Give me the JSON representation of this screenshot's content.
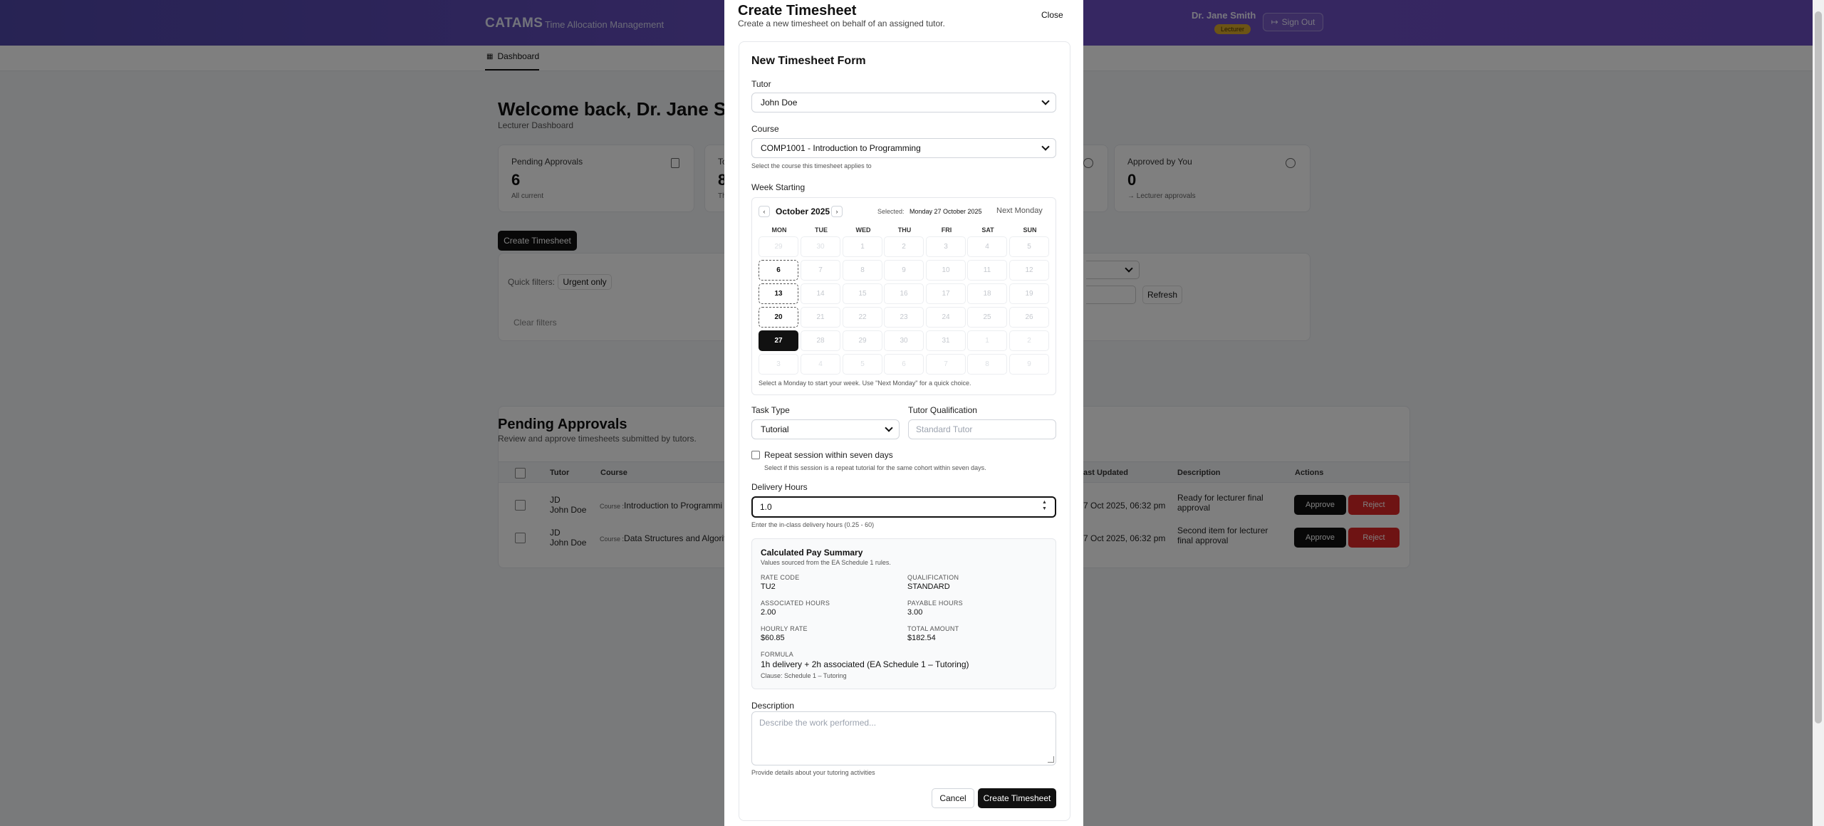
{
  "app": {
    "brand": "CATAMS",
    "brand_sub": "Time Allocation Management",
    "user_name": "Dr. Jane Smith",
    "role": "Lecturer",
    "sign_out": "Sign Out",
    "nav_dashboard": "Dashboard"
  },
  "dashboard": {
    "welcome": "Welcome back, Dr. Jane Smith",
    "subtitle": "Lecturer Dashboard",
    "stats": [
      {
        "label": "Pending Approvals",
        "value": "6",
        "note": "All current"
      },
      {
        "label": "To",
        "value": "8",
        "note": "Th"
      },
      {
        "label": "Approved by You",
        "value": "0",
        "note": "→ Lecturer approvals"
      }
    ],
    "create_btn": "Create Timesheet",
    "quick_filters_label": "Quick filters:",
    "urgent_only": "Urgent only",
    "clear_filters": "Clear filters",
    "refresh": "Refresh"
  },
  "pending": {
    "title": "Pending Approvals",
    "subtitle": "Review and approve timesheets submitted by tutors.",
    "headers": {
      "tutor": "Tutor",
      "course": "Course",
      "updated": "ast Updated",
      "description": "Description",
      "actions": "Actions"
    },
    "rows": [
      {
        "initials": "JD",
        "name": "John Doe",
        "course_tag": "Course",
        "course": "Introduction to Programmi",
        "updated": "7 Oct 2025, 06:32 pm",
        "description": "Ready for lecturer final approval"
      },
      {
        "initials": "JD",
        "name": "John Doe",
        "course_tag": "Course",
        "course": "Data Structures and Algorit",
        "updated": "7 Oct 2025, 06:32 pm",
        "description": "Second item for lecturer final approval"
      }
    ],
    "approve": "Approve",
    "reject": "Reject"
  },
  "modal": {
    "title": "Create Timesheet",
    "subtitle": "Create a new timesheet on behalf of an assigned tutor.",
    "close": "Close",
    "form_title": "New Timesheet Form",
    "tutor_label": "Tutor",
    "tutor_value": "John Doe",
    "course_label": "Course",
    "course_value": "COMP1001 - Introduction to Programming",
    "course_hint": "Select the course this timesheet applies to",
    "week_label": "Week Starting",
    "calendar": {
      "prev": "‹",
      "next": "›",
      "month": "October 2025",
      "selected_label": "Selected:",
      "selected_value": "Monday 27 October 2025",
      "next_monday": "Next Monday",
      "weekdays": [
        "MON",
        "TUE",
        "WED",
        "THU",
        "FRI",
        "SAT",
        "SUN"
      ],
      "weeks": [
        [
          "29",
          "30",
          "1",
          "2",
          "3",
          "4",
          "5"
        ],
        [
          "6",
          "7",
          "8",
          "9",
          "10",
          "11",
          "12"
        ],
        [
          "13",
          "14",
          "15",
          "16",
          "17",
          "18",
          "19"
        ],
        [
          "20",
          "21",
          "22",
          "23",
          "24",
          "25",
          "26"
        ],
        [
          "27",
          "28",
          "29",
          "30",
          "31",
          "1",
          "2"
        ],
        [
          "3",
          "4",
          "5",
          "6",
          "7",
          "8",
          "9"
        ]
      ],
      "hint": "Select a Monday to start your week. Use \"Next Monday\" for a quick choice."
    },
    "task_type_label": "Task Type",
    "task_type_value": "Tutorial",
    "qualification_label": "Tutor Qualification",
    "qualification_placeholder": "Standard Tutor",
    "repeat_label": "Repeat session within seven days",
    "repeat_hint": "Select if this session is a repeat tutorial for the same cohort within seven days.",
    "hours_label": "Delivery Hours",
    "hours_value": "1.0",
    "hours_hint": "Enter the in-class delivery hours (0.25 - 60)",
    "pay": {
      "title": "Calculated Pay Summary",
      "subtitle": "Values sourced from the EA Schedule 1 rules.",
      "rate_code_label": "RATE CODE",
      "rate_code": "TU2",
      "qualification_label": "QUALIFICATION",
      "qualification": "STANDARD",
      "associated_label": "ASSOCIATED HOURS",
      "associated": "2.00",
      "payable_label": "PAYABLE HOURS",
      "payable": "3.00",
      "hourly_label": "HOURLY RATE",
      "hourly": "$60.85",
      "total_label": "TOTAL AMOUNT",
      "total": "$182.54",
      "formula_label": "FORMULA",
      "formula": "1h delivery + 2h associated (EA Schedule 1 – Tutoring)",
      "clause": "Clause: Schedule 1 – Tutoring"
    },
    "description_label": "Description",
    "description_placeholder": "Describe the work performed...",
    "description_hint": "Provide details about your tutoring activities",
    "cancel": "Cancel",
    "submit": "Create Timesheet"
  }
}
